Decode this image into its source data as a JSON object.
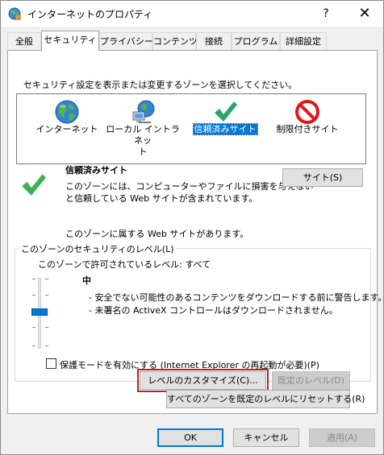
{
  "window": {
    "title": "インターネットのプロパティ",
    "help_label": "?",
    "close_label": "✕"
  },
  "tabs": [
    {
      "label": "全般"
    },
    {
      "label": "セキュリティ",
      "active": true
    },
    {
      "label": "プライバシー"
    },
    {
      "label": "コンテンツ"
    },
    {
      "label": "接続"
    },
    {
      "label": "プログラム"
    },
    {
      "label": "詳細設定"
    }
  ],
  "security": {
    "instruction": "セキュリティ設定を表示または変更するゾーンを選択してください。",
    "zones": [
      {
        "label": "インターネット",
        "icon": "globe-icon"
      },
      {
        "label_line1": "ローカル イントラネッ",
        "label_line2": "ト",
        "icon": "intranet-icon"
      },
      {
        "label": "信頼済みサイト",
        "icon": "checkmark-icon",
        "selected": true
      },
      {
        "label": "制限付きサイト",
        "icon": "restricted-icon"
      }
    ],
    "zone_detail": {
      "title": "信頼済みサイト",
      "desc_line1": "このゾーンには、コンピューターやファイルに損害を与えない",
      "desc_line2": "と信頼している Web サイトが含まれています。",
      "sites_button": "サイト(S)",
      "sites_note": "このゾーンに属する Web サイトがあります。"
    },
    "level_group": {
      "legend": "このゾーンのセキュリティのレベル(L)",
      "allowed_text": "このゾーンで許可されているレベル: すべて",
      "level_name": "中",
      "bullet1": "- 安全でない可能性のあるコンテンツをダウンロードする前に警告します。",
      "bullet2": "- 未署名の ActiveX コントロールはダウンロードされません。",
      "slider_level": "中"
    },
    "protected_mode": {
      "label": "保護モードを有効にする (Internet Explorer の再起動が必要)(P)",
      "checked": false
    },
    "custom_level_button": "レベルのカスタマイズ(C)...",
    "default_level_button": "既定のレベル(D)",
    "reset_all_button": "すべてのゾーンを既定のレベルにリセットする(R)"
  },
  "footer": {
    "ok": "OK",
    "cancel": "キャンセル",
    "apply": "適用(A)"
  },
  "colors": {
    "accent": "#0078d7",
    "check_green": "#2aa66b",
    "restricted_red": "#e0161b"
  }
}
